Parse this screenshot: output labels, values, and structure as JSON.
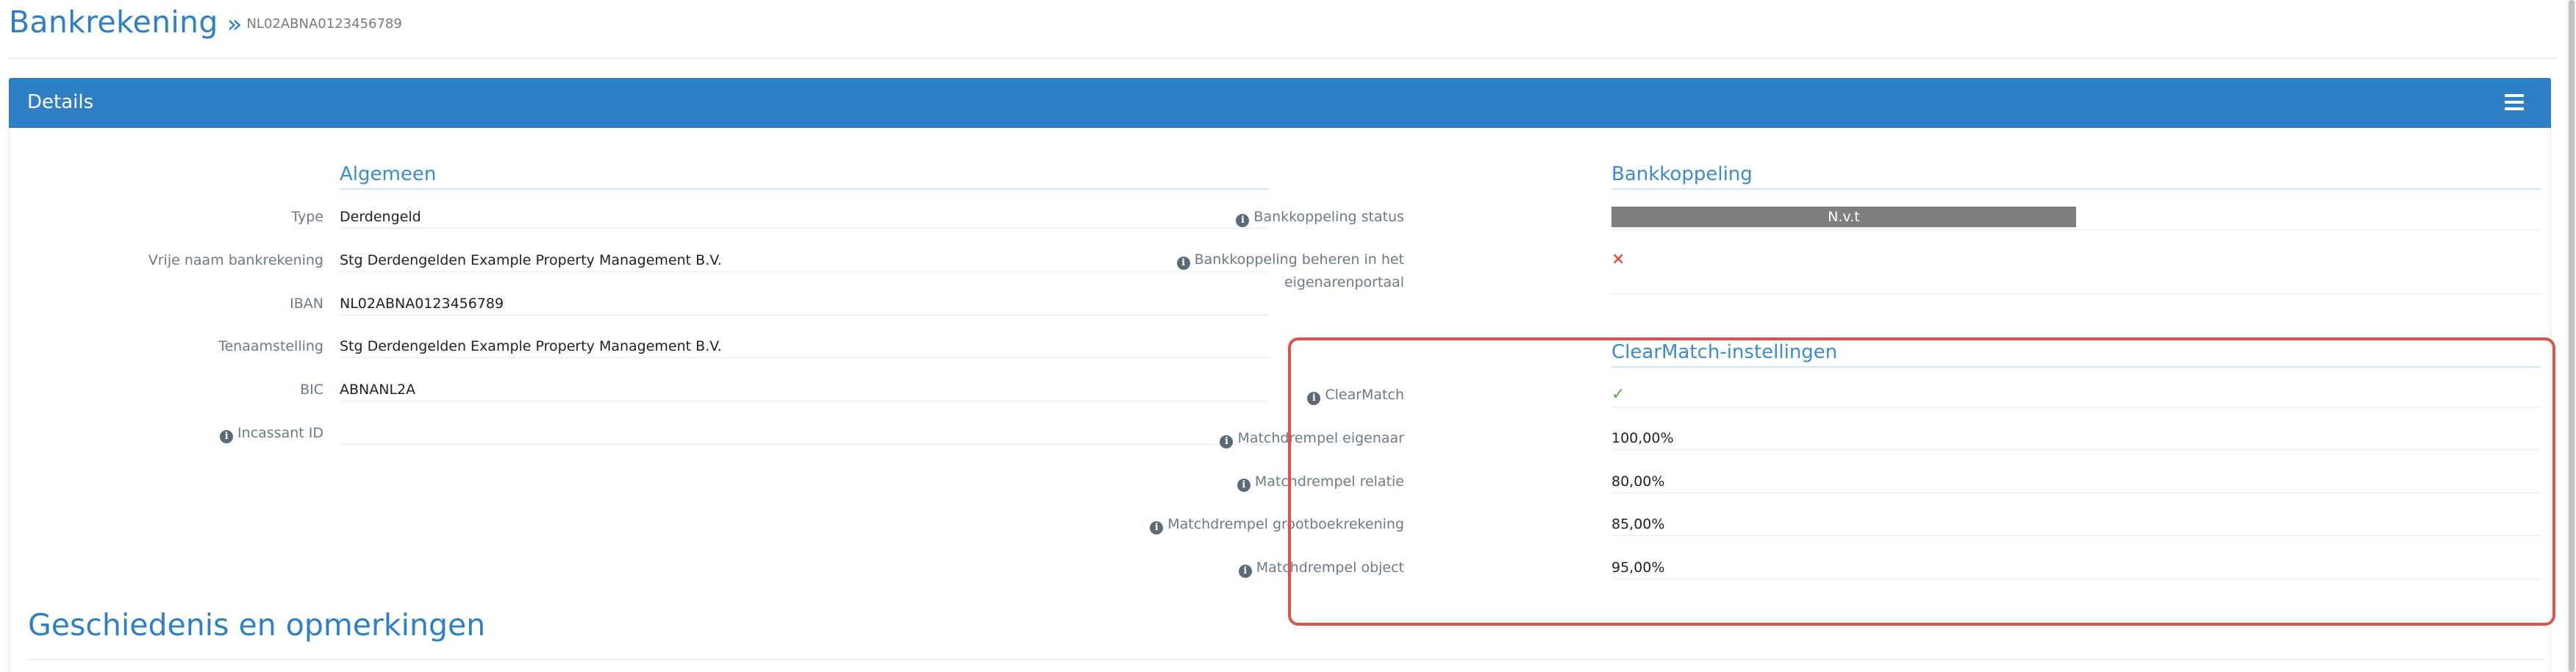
{
  "header": {
    "title": "Bankrekening",
    "separator": "»",
    "iban": "NL02ABNA0123456789"
  },
  "panel": {
    "title": "Details",
    "menu_icon": "hamburger-menu-icon"
  },
  "algemeen": {
    "heading": "Algemeen",
    "fields": [
      {
        "label": "Type",
        "value": "Derdengeld"
      },
      {
        "label": "Vrije naam bankrekening",
        "value": "Stg Derdengelden Example Property Management B.V."
      },
      {
        "label": "IBAN",
        "value": "NL02ABNA0123456789"
      },
      {
        "label": "Tenaamstelling",
        "value": "Stg Derdengelden Example Property Management B.V."
      },
      {
        "label": "BIC",
        "value": "ABNANL2A"
      },
      {
        "label": "Incassant ID",
        "value": ""
      }
    ]
  },
  "bankkoppeling": {
    "heading": "Bankkoppeling",
    "status_label": "Bankkoppeling status",
    "status_value": "N.v.t",
    "status_color": "#7f7f7f",
    "beheren_label_line1": "Bankkoppeling beheren in het",
    "beheren_label_line2": "eigenarenportaal",
    "beheren_value": "×"
  },
  "clearmatch": {
    "heading": "ClearMatch-instellingen",
    "clearmatch_label": "ClearMatch",
    "clearmatch_value": "✓",
    "fields": [
      {
        "label": "Matchdrempel eigenaar",
        "value": "100,00%"
      },
      {
        "label": "Matchdrempel relatie",
        "value": "80,00%"
      },
      {
        "label": "Matchdrempel grootboekrekening",
        "value": "85,00%"
      },
      {
        "label": "Matchdrempel object",
        "value": "95,00%"
      }
    ]
  },
  "history": {
    "title": "Geschiedenis en opmerkingen"
  },
  "info_icon_glyph": "i",
  "colors": {
    "accent": "#2f7fc4",
    "highlight": "#d9534f",
    "success": "#4cae4c",
    "danger": "#d9534f"
  }
}
